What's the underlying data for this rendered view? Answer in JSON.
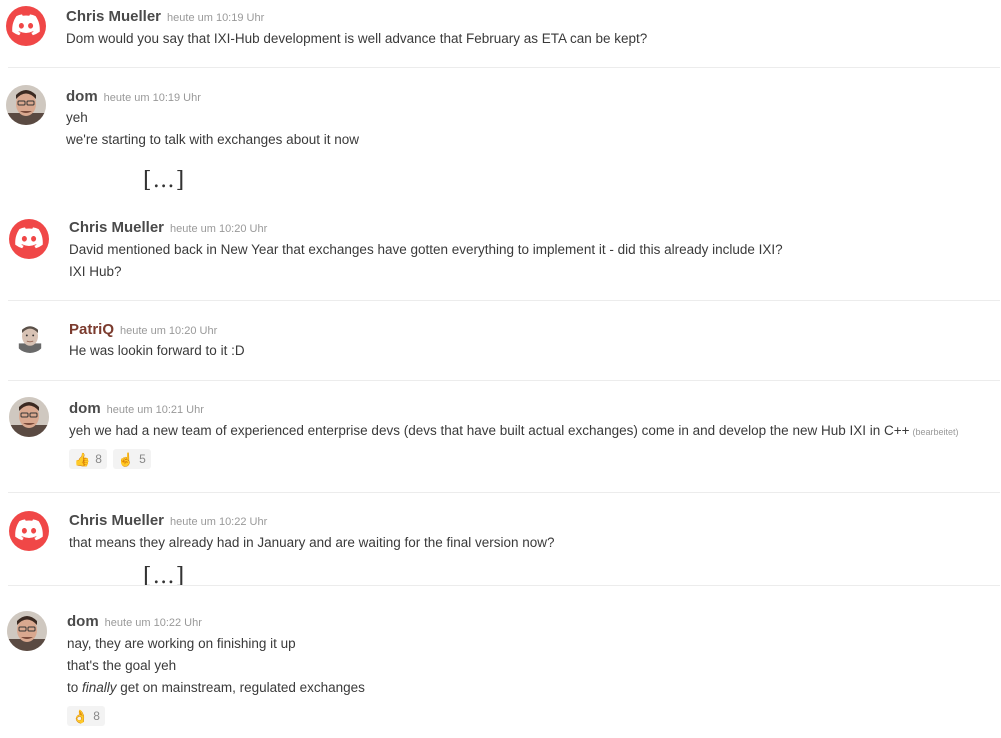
{
  "messages": [
    {
      "author": "Chris Mueller",
      "timestamp": "heute um 10:19 Uhr",
      "lines": [
        "Dom would you say that IXI-Hub development is well advance that February as ETA can be kept?"
      ]
    },
    {
      "author": "dom",
      "timestamp": "heute um 10:19 Uhr",
      "lines": [
        "yeh",
        "we're starting to talk with exchanges about it now"
      ]
    },
    {
      "author": "Chris Mueller",
      "timestamp": "heute um 10:20 Uhr",
      "lines": [
        "David mentioned back in New Year that exchanges have gotten everything to implement it - did this already include IXI?",
        "IXI Hub?"
      ]
    },
    {
      "author": "PatriQ",
      "timestamp": "heute um 10:20 Uhr",
      "lines": [
        "He was lookin forward to it :D"
      ]
    },
    {
      "author": "dom",
      "timestamp": "heute um 10:21 Uhr",
      "lines": [
        "yeh we had a new team of experienced enterprise devs (devs that have built actual exchanges) come in and develop the new Hub IXI in C++"
      ],
      "edited": "(bearbeitet)",
      "reactions": [
        {
          "emoji": "👍",
          "count": "8"
        },
        {
          "emoji": "☝",
          "count": "5"
        }
      ]
    },
    {
      "author": "Chris Mueller",
      "timestamp": "heute um 10:22 Uhr",
      "lines": [
        "that means they already had in January and are waiting for the final version now?"
      ]
    },
    {
      "author": "dom",
      "timestamp": "heute um 10:22 Uhr",
      "lines": [
        "nay, they are working on finishing it up",
        "that's the goal yeh"
      ],
      "line3_prefix": "to ",
      "line3_italic": "finally",
      "line3_suffix": " get on mainstream, regulated exchanges",
      "reactions": [
        {
          "emoji": "👌",
          "count": "8"
        }
      ]
    }
  ],
  "omission_marker": "[…]",
  "colors": {
    "discord_avatar": "#f04747",
    "patriq_name": "#7b3b2e",
    "timestamp": "#999999"
  },
  "icons": {
    "discord_avatar": "discord-logo-icon",
    "user_avatar": "user-photo-avatar"
  }
}
